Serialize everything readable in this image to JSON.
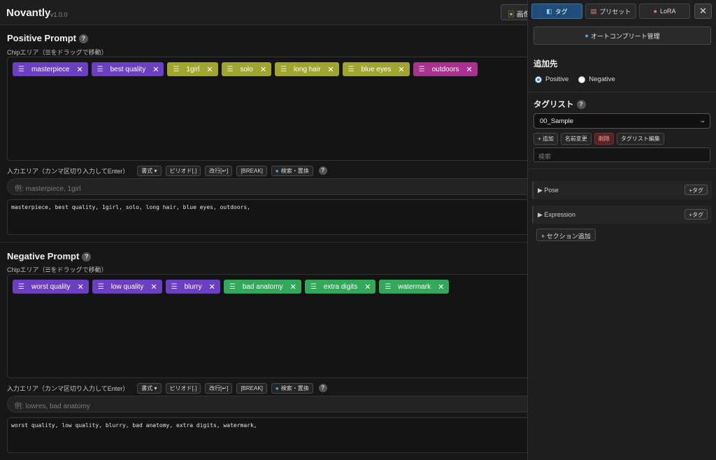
{
  "app": {
    "name": "Novantly",
    "version": "v1.0.0",
    "image_button": "画像"
  },
  "positive": {
    "title": "Positive Prompt",
    "help": "?",
    "chip_label": "Chipエリア（☰をドラッグで移動）",
    "chips": [
      {
        "text": "masterpiece",
        "color": "#6b3fc1"
      },
      {
        "text": "best quality",
        "color": "#6b3fc1"
      },
      {
        "text": "1girl",
        "color": "#9fa62e"
      },
      {
        "text": "solo",
        "color": "#9fa62e"
      },
      {
        "text": "long hair",
        "color": "#9fa62e"
      },
      {
        "text": "blue eyes",
        "color": "#9fa62e"
      },
      {
        "text": "outdoors",
        "color": "#a8338f"
      }
    ],
    "input_label": "入力エリア（カンマ区切り入力してEnter）",
    "placeholder": "例: masterpiece, 1girl",
    "output": "masterpiece, best quality, 1girl, solo, long hair, blue eyes, outdoors,"
  },
  "negative": {
    "title": "Negative Prompt",
    "help": "?",
    "chip_label": "Chipエリア（☰をドラッグで移動）",
    "chips": [
      {
        "text": "worst quality",
        "color": "#6b3fc1"
      },
      {
        "text": "low quality",
        "color": "#6b3fc1"
      },
      {
        "text": "blurry",
        "color": "#6b3fc1"
      },
      {
        "text": "bad anatomy",
        "color": "#33a85a"
      },
      {
        "text": "extra digits",
        "color": "#33a85a"
      },
      {
        "text": "watermark",
        "color": "#33a85a"
      }
    ],
    "input_label": "入力エリア（カンマ区切り入力してEnter）",
    "placeholder": "例: lowres, bad anatomy",
    "output": "worst quality, low quality, blurry, bad anatomy, extra digits, watermark,"
  },
  "toolbar": {
    "format": "書式 ▾",
    "period": "ピリオド[.]",
    "newline": "改行[↵]",
    "break": "[BREAK]",
    "search_replace": "検索・置換",
    "help": "?"
  },
  "sidebar": {
    "tabs": [
      {
        "label": "タグ",
        "icon": "tag-icon",
        "active": true
      },
      {
        "label": "プリセット",
        "icon": "clipboard-icon",
        "active": false
      },
      {
        "label": "LoRA",
        "icon": "palette-icon",
        "active": false
      }
    ],
    "close": "✕",
    "autocomplete": "オートコンプリート管理",
    "target_title": "追加先",
    "target_options": [
      "Positive",
      "Negative"
    ],
    "target_selected": "Positive",
    "taglist_title": "タグリスト",
    "taglist_help": "?",
    "taglist_selected": "00_Sample",
    "buttons": {
      "add": "+ 追加",
      "rename": "名前変更",
      "delete": "削除",
      "edit": "タグリスト編集"
    },
    "search_placeholder": "検索",
    "sections": [
      {
        "label": "▶ Pose",
        "add": "+タグ"
      },
      {
        "label": "▶ Expression",
        "add": "+タグ"
      }
    ],
    "add_section": "+ セクション追加"
  }
}
